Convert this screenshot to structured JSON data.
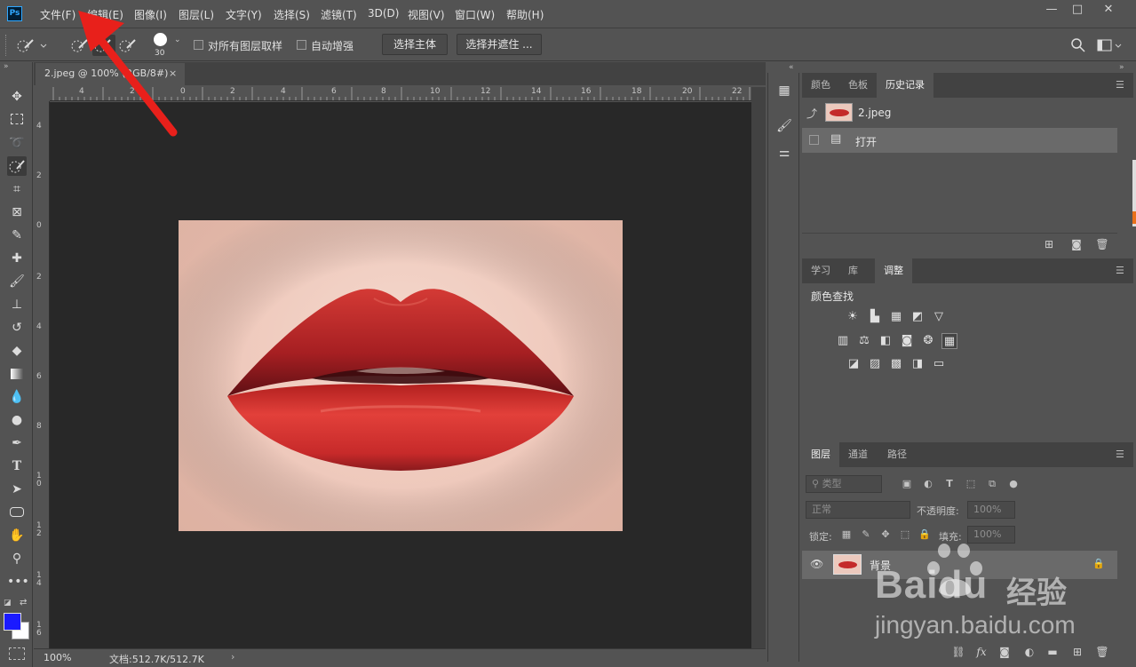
{
  "app": {
    "logo": "Ps"
  },
  "menu": [
    "文件(F)",
    "编辑(E)",
    "图像(I)",
    "图层(L)",
    "文字(Y)",
    "选择(S)",
    "滤镜(T)",
    "3D(D)",
    "视图(V)",
    "窗口(W)",
    "帮助(H)"
  ],
  "window_controls": {
    "minimize": "—",
    "maximize": "□",
    "close": "✕"
  },
  "options": {
    "brush_size": "30",
    "sample_all_label": "对所有图层取样",
    "auto_enhance_label": "自动增强",
    "select_subject": "选择主体",
    "select_and_mask": "选择并遮住 ..."
  },
  "document": {
    "tab_title": "2.jpeg @ 100% (RGB/8#)",
    "tab_close": "×",
    "zoom": "100%",
    "doc_info": "文档:512.7K/512.7K",
    "status_arrow": "›",
    "ruler_h": [
      "4",
      "2",
      "0",
      "2",
      "4",
      "6",
      "8",
      "10",
      "12",
      "14",
      "16",
      "18",
      "20",
      "22"
    ],
    "ruler_v": [
      "4",
      "2",
      "0",
      "2",
      "4",
      "6",
      "8",
      "10",
      "12",
      "14",
      "16"
    ]
  },
  "history_panel": {
    "tabs": [
      "颜色",
      "色板",
      "历史记录"
    ],
    "active_tab": 2,
    "snapshot": "2.jpeg",
    "states": [
      "打开"
    ]
  },
  "adjustments_panel": {
    "tabs": [
      "学习",
      "库",
      "调整"
    ],
    "active_tab": 2,
    "subtitle": "颜色查找"
  },
  "layers_panel": {
    "tabs": [
      "图层",
      "通道",
      "路径"
    ],
    "active_tab": 0,
    "filter_kind": "类型",
    "blend_mode": "正常",
    "opacity_label": "不透明度:",
    "opacity": "100%",
    "lock_label": "锁定:",
    "fill_label": "填充:",
    "fill": "100%",
    "layers": [
      {
        "name": "背景",
        "locked": true,
        "visible": true
      }
    ]
  },
  "watermark": {
    "brand": "Baidu",
    "suffix": "经验",
    "url": "jingyan.baidu.com"
  },
  "colors": {
    "foreground": "#1a1aff",
    "background": "#ffffff",
    "accent_arrow": "#e8201b"
  }
}
